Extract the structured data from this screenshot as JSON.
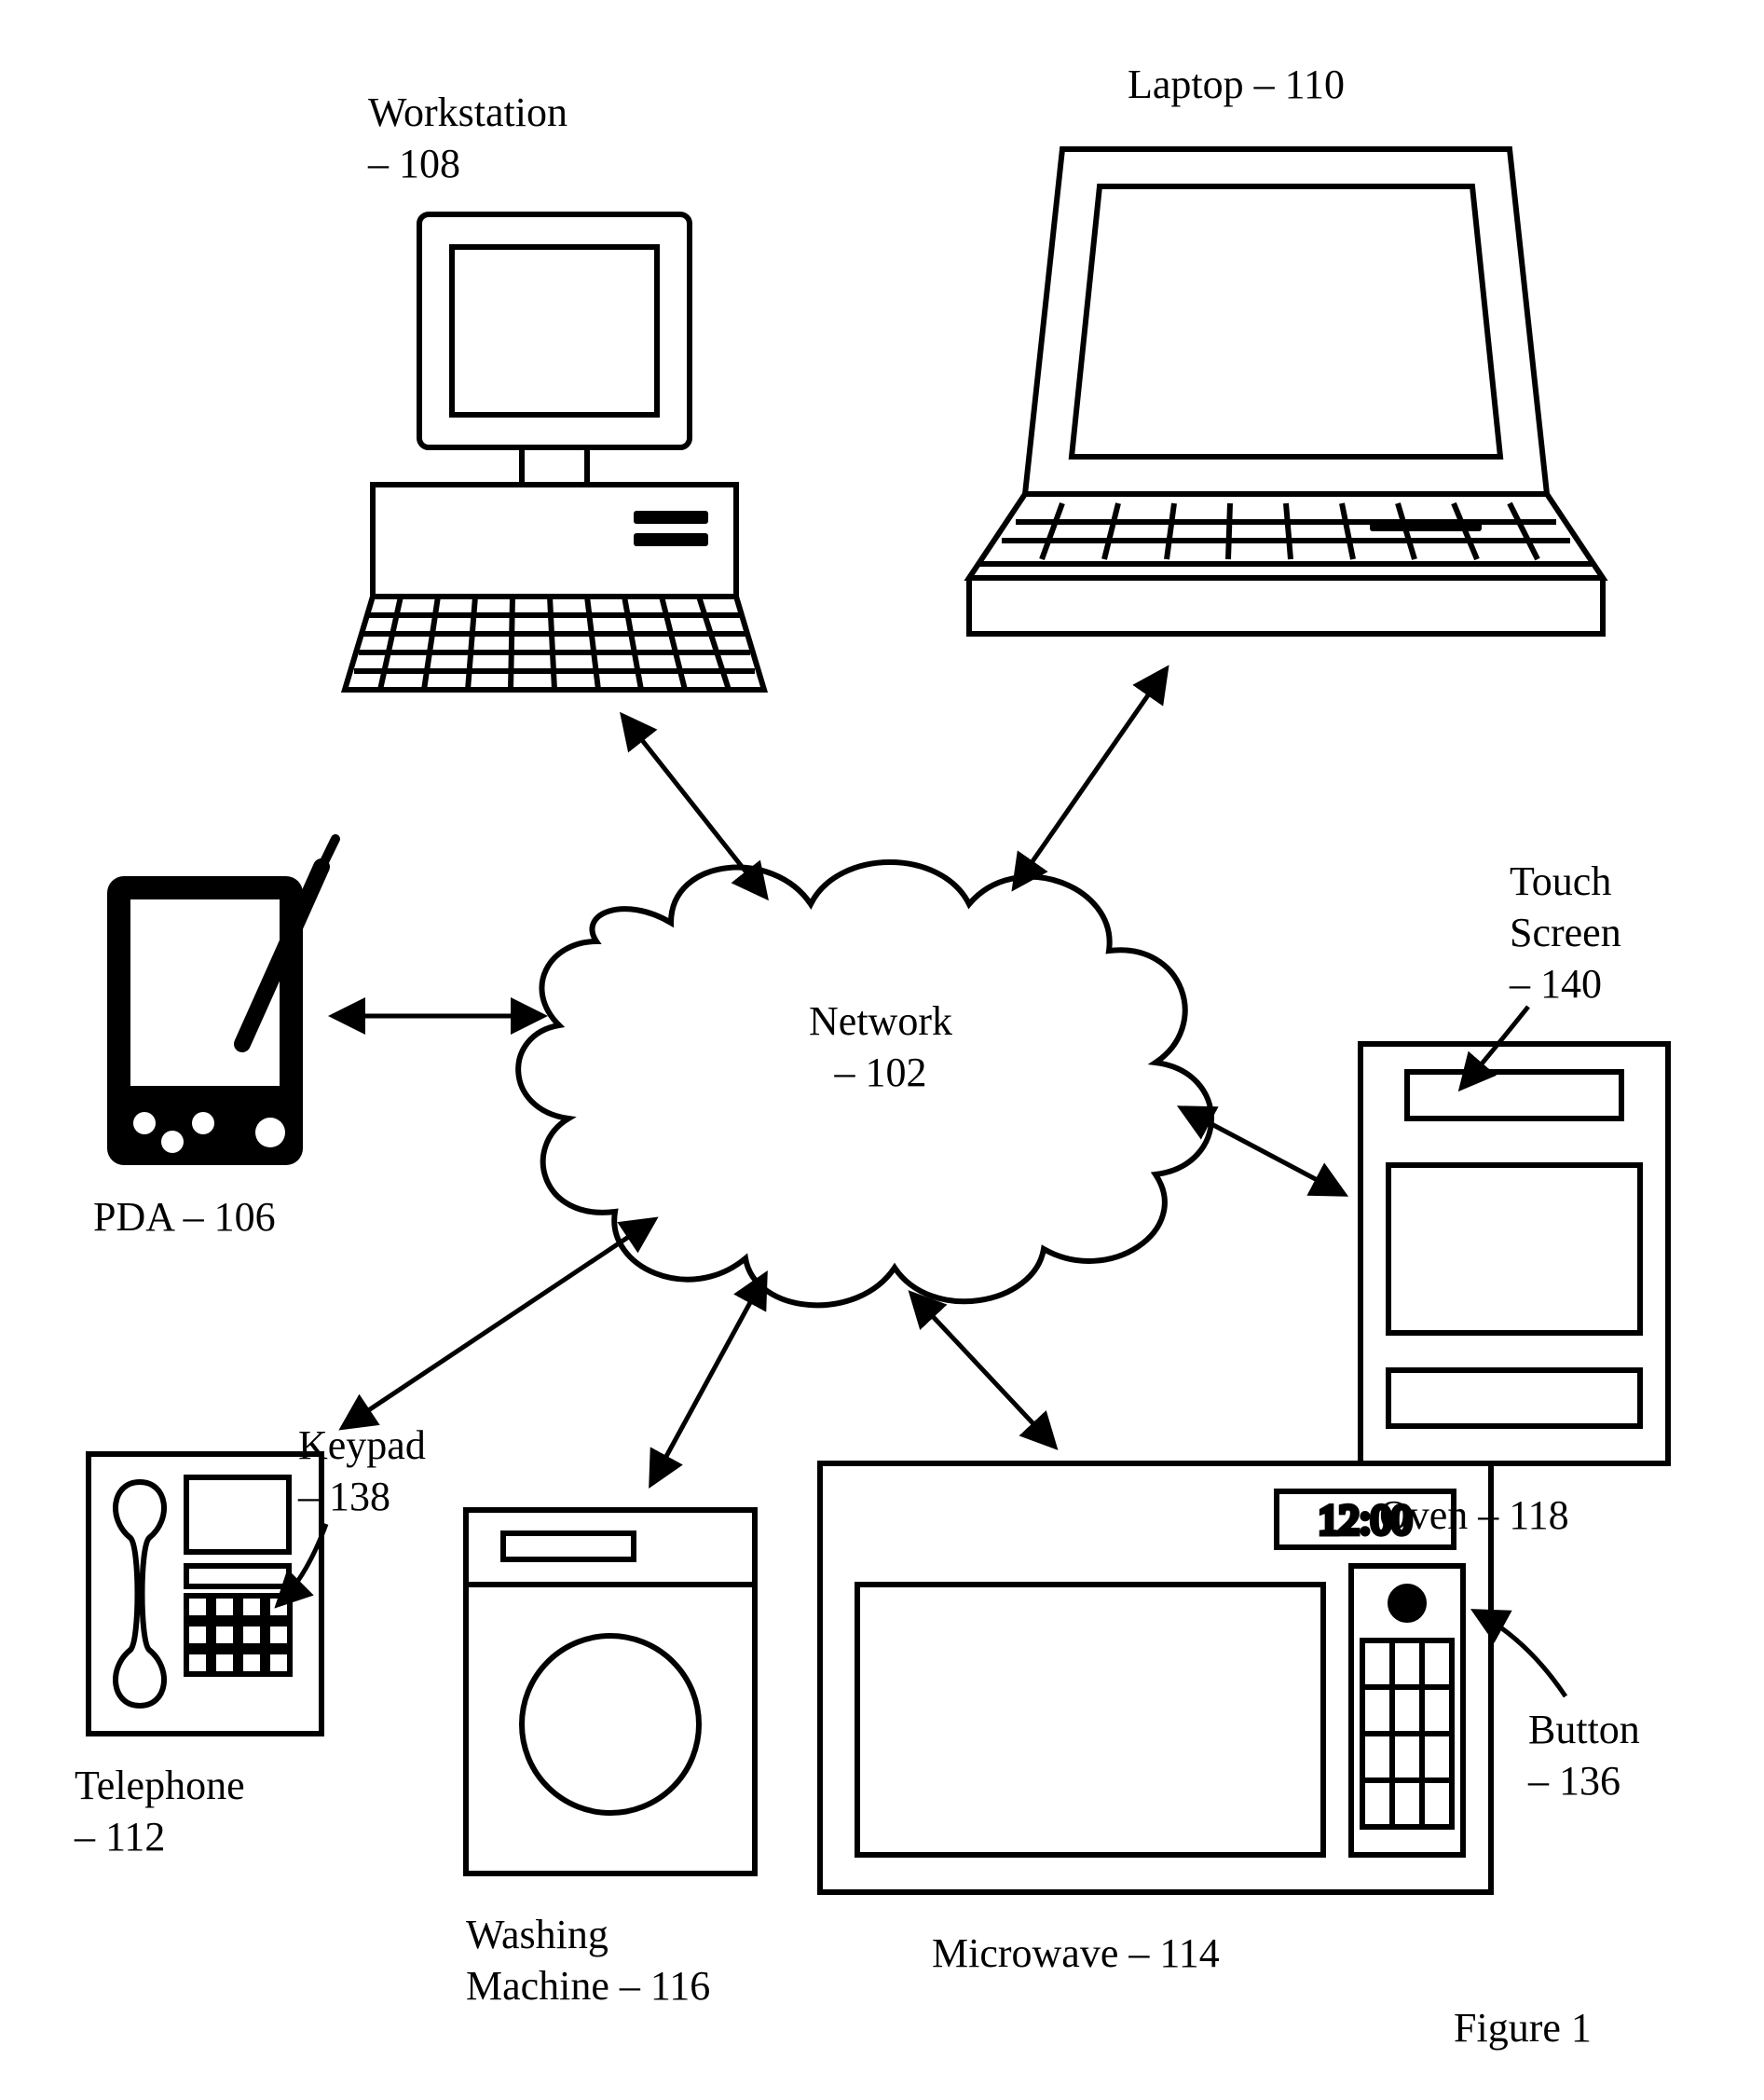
{
  "figure_label": "Figure 1",
  "network": {
    "name": "Network",
    "ref": "– 102"
  },
  "workstation": {
    "name": "Workstation",
    "ref": "– 108"
  },
  "laptop": {
    "name": "Laptop – 110"
  },
  "pda": {
    "name": "PDA – 106"
  },
  "touchscreen": {
    "l1": "Touch",
    "l2": "Screen",
    "ref": "– 140"
  },
  "oven": {
    "name": "Oven – 118"
  },
  "keypad": {
    "name": "Keypad",
    "ref": "– 138"
  },
  "telephone": {
    "name": "Telephone",
    "ref": "– 112"
  },
  "washing": {
    "l1": "Washing",
    "l2": "Machine – 116"
  },
  "microwave": {
    "name": "Microwave – 114",
    "clock": "12:00"
  },
  "button": {
    "name": "Button",
    "ref": "– 136"
  }
}
